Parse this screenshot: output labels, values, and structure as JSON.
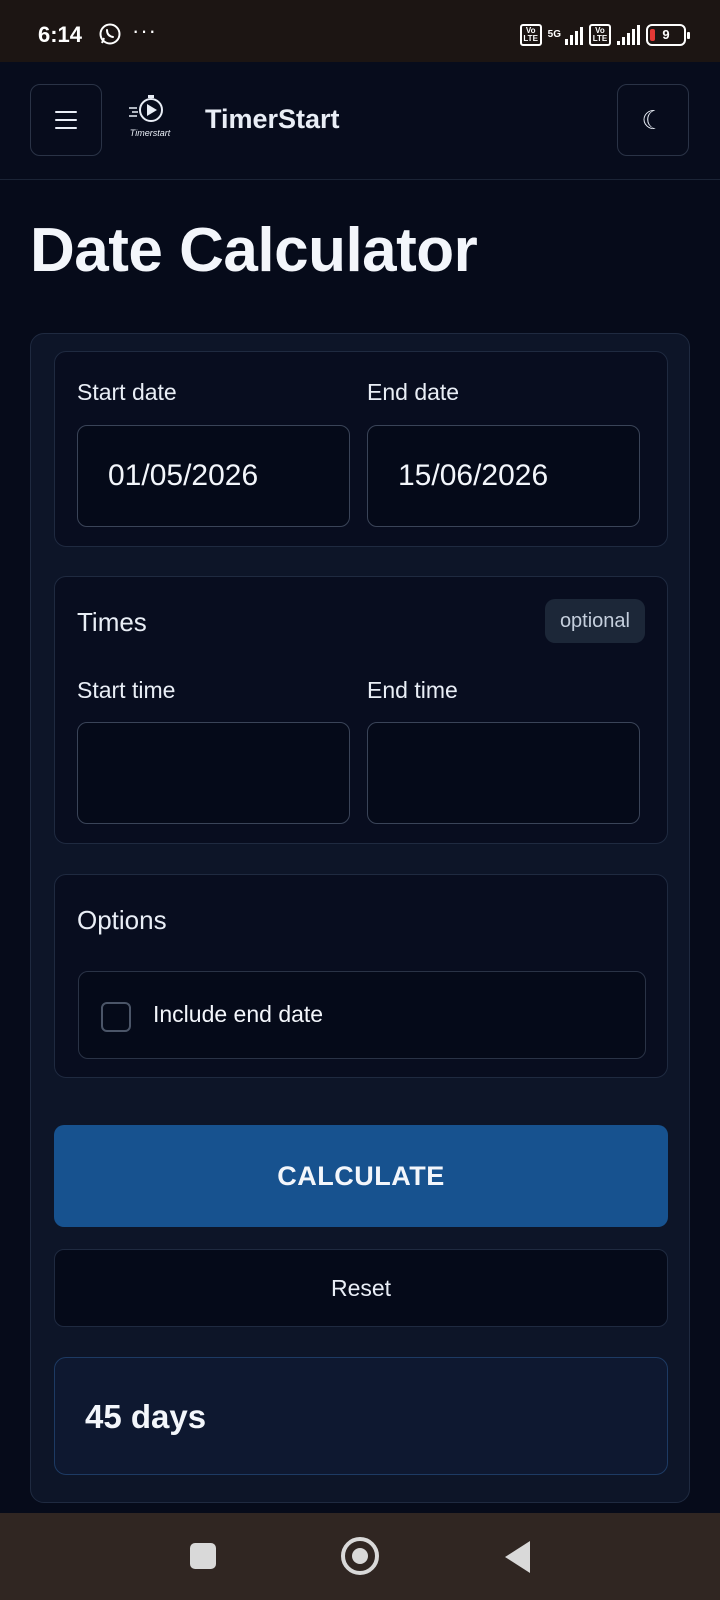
{
  "status_bar": {
    "time": "6:14",
    "more": "···",
    "network": "5G",
    "volte": "Vo LTE",
    "battery": "9",
    "icons": [
      "whatsapp-icon",
      "signal-icon",
      "battery-icon"
    ]
  },
  "header": {
    "brand": "TimerStart",
    "logo_text": "Timerstart",
    "menu_icon": "hamburger-icon",
    "theme_icon": "moon-icon",
    "theme_glyph": "☾"
  },
  "page": {
    "title": "Date Calculator"
  },
  "dates": {
    "start_label": "Start date",
    "start_value": "01/05/2026",
    "end_label": "End date",
    "end_value": "15/06/2026"
  },
  "times": {
    "title": "Times",
    "badge": "optional",
    "start_label": "Start time",
    "start_value": "",
    "end_label": "End time",
    "end_value": ""
  },
  "options": {
    "title": "Options",
    "include_end_label": "Include end date",
    "include_end_checked": false
  },
  "actions": {
    "calculate_label": "CALCULATE",
    "reset_label": "Reset"
  },
  "result": {
    "value": "45 days"
  },
  "colors": {
    "background": "#060b1a",
    "accent": "#17528f",
    "card": "#0d1528"
  }
}
